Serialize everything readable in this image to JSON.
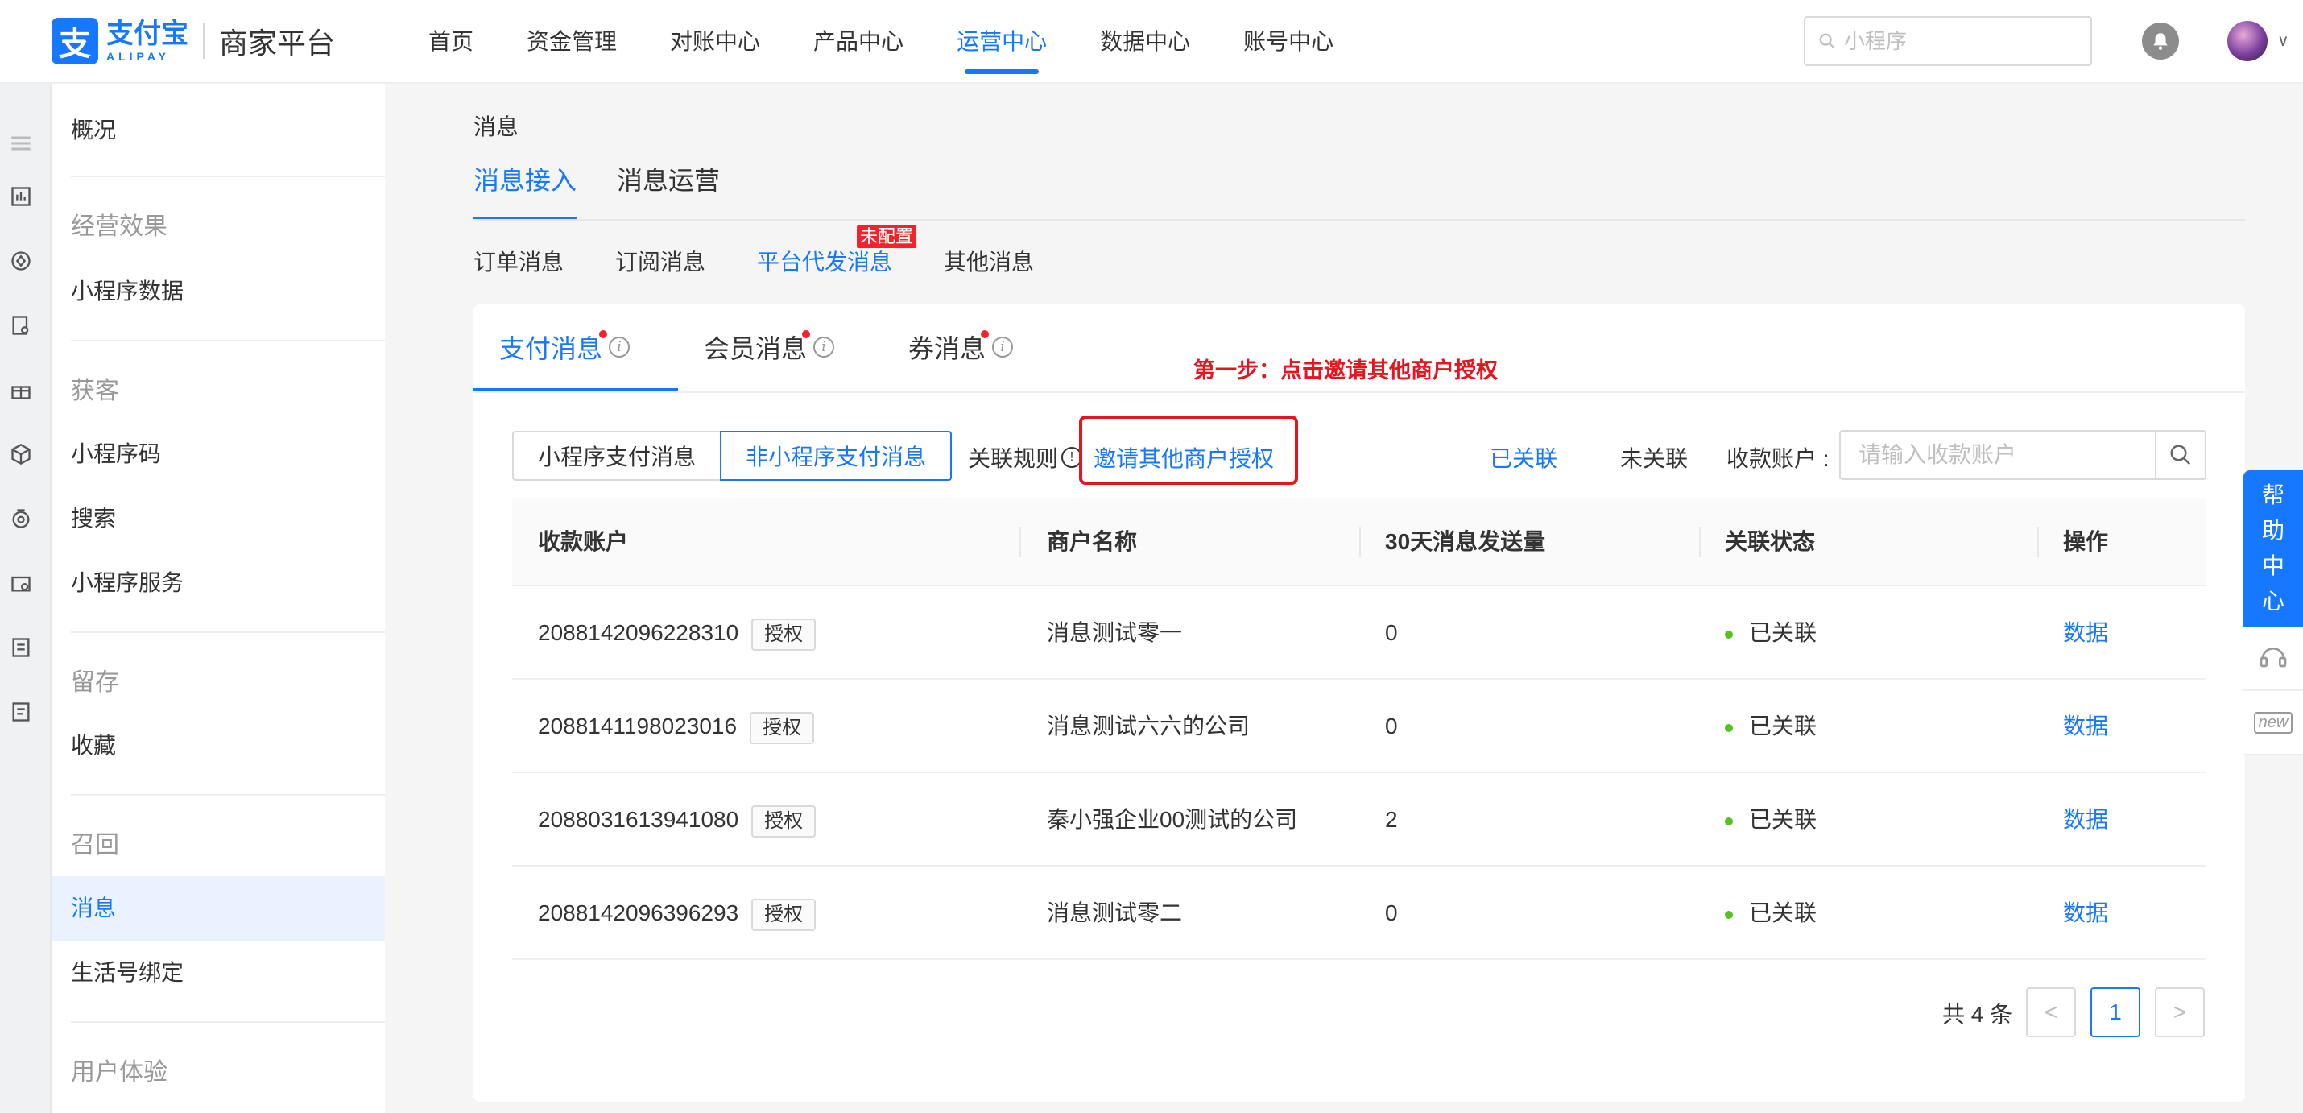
{
  "header": {
    "logo_cn": "支付宝",
    "logo_en": "ALIPAY",
    "platform": "商家平台",
    "nav": [
      {
        "label": "首页"
      },
      {
        "label": "资金管理"
      },
      {
        "label": "对账中心"
      },
      {
        "label": "产品中心"
      },
      {
        "label": "运营中心"
      },
      {
        "label": "数据中心"
      },
      {
        "label": "账号中心"
      }
    ],
    "active_nav": "运营中心",
    "search_placeholder": "小程序"
  },
  "sidebar": {
    "overview": "概况",
    "groups": [
      {
        "title": "经营效果",
        "items": [
          "小程序数据"
        ]
      },
      {
        "title": "获客",
        "items": [
          "小程序码",
          "搜索",
          "小程序服务"
        ]
      },
      {
        "title": "留存",
        "items": [
          "收藏"
        ]
      },
      {
        "title": "召回",
        "items": [
          "消息",
          "生活号绑定"
        ]
      },
      {
        "title": "用户体验",
        "items": []
      }
    ],
    "active_item": "消息"
  },
  "main": {
    "breadcrumb": "消息",
    "tabs": [
      "消息接入",
      "消息运营"
    ],
    "subtabs": [
      "订单消息",
      "订阅消息",
      "平台代发消息",
      "其他消息"
    ],
    "unconfigured_badge": "未配置",
    "msg_tabs": [
      "支付消息",
      "会员消息",
      "券消息"
    ],
    "annotation": "第一步：点击邀请其他商户授权",
    "segments": [
      "小程序支付消息",
      "非小程序支付消息"
    ],
    "rule_label": "关联规则",
    "invite_link": "邀请其他商户授权",
    "filter_linked": "已关联",
    "filter_unlinked": "未关联",
    "account_label": "收款账户 :",
    "account_placeholder": "请输入收款账户"
  },
  "table": {
    "columns": [
      "收款账户",
      "商户名称",
      "30天消息发送量",
      "关联状态",
      "操作"
    ],
    "auth_label": "授权",
    "rows": [
      {
        "account": "2088142096228310",
        "merchant": "消息测试零一",
        "count": "0",
        "status": "已关联",
        "action": "数据"
      },
      {
        "account": "2088141198023016",
        "merchant": "消息测试六六的公司",
        "count": "0",
        "status": "已关联",
        "action": "数据"
      },
      {
        "account": "2088031613941080",
        "merchant": "秦小强企业00测试的公司",
        "count": "2",
        "status": "已关联",
        "action": "数据"
      },
      {
        "account": "2088142096396293",
        "merchant": "消息测试零二",
        "count": "0",
        "status": "已关联",
        "action": "数据"
      }
    ]
  },
  "pagination": {
    "total": "共 4 条",
    "prev": "<",
    "page": "1",
    "next": ">"
  },
  "help": {
    "chars": [
      "帮",
      "助",
      "中",
      "心"
    ],
    "tool_new": "new"
  },
  "colors": {
    "primary": "#1677ff",
    "annotation_red": "#e8131c",
    "status_green": "#52c41a"
  }
}
